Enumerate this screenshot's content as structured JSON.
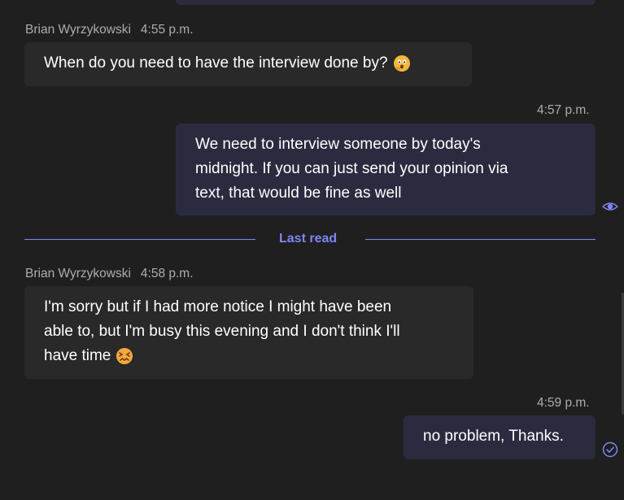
{
  "messages": [
    {
      "author": "Brian Wyrzykowski",
      "time": "4:55 p.m.",
      "lines": [
        "When do you need to have the interview done by?"
      ],
      "emoji": "thinking-face-emoji"
    },
    {
      "time": "4:57 p.m.",
      "lines": [
        "We need to interview someone by today's",
        "midnight. If you can just send your opinion via",
        "text, that would be fine as well"
      ],
      "status_icon": "seen-eye-icon"
    },
    {
      "author": "Brian Wyrzykowski",
      "time": "4:58 p.m.",
      "lines": [
        "I'm sorry but if I had more notice I might have been",
        "able to, but I'm busy this evening and I don't think I'll",
        "have time"
      ],
      "emoji": "confounded-face-emoji"
    },
    {
      "time": "4:59 p.m.",
      "lines": [
        "no problem, Thanks."
      ],
      "status_icon": "sent-check-icon"
    }
  ],
  "divider": {
    "label": "Last read"
  },
  "colors": {
    "background": "#1f1f1f",
    "incoming_bubble": "#292929",
    "outgoing_bubble": "#2b2b40",
    "accent": "#7f85f5",
    "meta_text": "#adadad"
  }
}
